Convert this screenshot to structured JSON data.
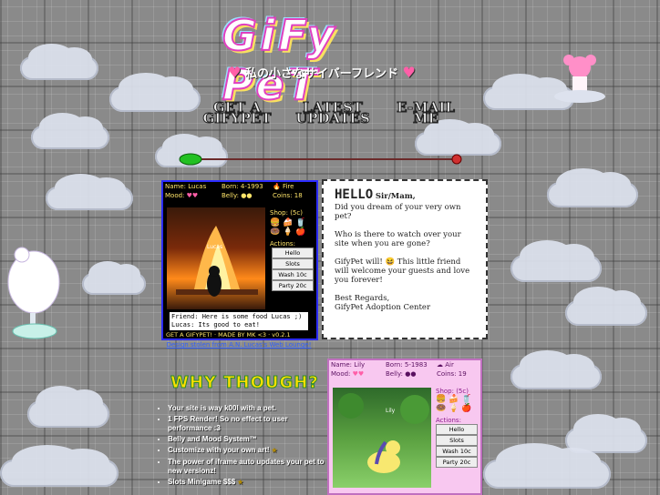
{
  "header": {
    "logo_text": "GiFy PeT",
    "subtitle": "私の小さなサイバーフレンド"
  },
  "nav": [
    {
      "line1": "GET A",
      "line2": "GIFYPET"
    },
    {
      "line1": "LATEST",
      "line2": "UPDATES"
    },
    {
      "line1": "E-MAIL",
      "line2": "ME"
    }
  ],
  "pet1": {
    "name": "Name: Lucas",
    "born": "Born: 4-1993",
    "element": "Fire",
    "mood": "Mood:",
    "belly": "Belly:",
    "coins": "Coins: 18",
    "shop": "Shop: (5c)",
    "actions": "Actions:",
    "buttons": [
      "Hello",
      "Slots",
      "Wash 10c",
      "Party 20c"
    ],
    "scene_label": "Lucas",
    "chat_line1": "Friend: Here is some food Lucas ;)",
    "chat_line2": "Lucas: Its good to eat!",
    "credit": "GET A GIFYPET! · MADE BY MK <3 · v0.2.1"
  },
  "stolen_link": "Design stolen from A.N. Lucas's Web Lounge!",
  "hello_box": {
    "hello": "HELLO",
    "salutation": "Sir/Mam,",
    "p1": "Did you dream of your very own pet?",
    "p2": "Who is there to watch over your site when you are gone?",
    "p3": "GifyPet will! 😆 This little friend will welcome your guests and love you forever!",
    "sign1": "Best Regards,",
    "sign2": "GifyPet Adoption Center"
  },
  "why": {
    "title": "WHY THOUGH?",
    "items": [
      "Your site is way k00l with a pet.",
      "1 FPS Render! So no effect to user performance :3",
      "Belly and Mood System™",
      "Customize with your own art!",
      "The power of iframe auto updates your pet to new versionz!",
      "Slots Minigame $$$"
    ]
  },
  "pet2": {
    "name": "Name: Lily",
    "born": "Born: 5-1983",
    "element": "Air",
    "mood": "Mood:",
    "belly": "Belly:",
    "coins": "Coins: 19",
    "shop": "Shop: (5c)",
    "actions": "Actions:",
    "buttons": [
      "Hello",
      "Slots",
      "Wash 10c",
      "Party 20c"
    ],
    "scene_label": "Lily"
  },
  "colors": {
    "accent_pink": "#ff5fa8",
    "link_blue": "#3060ff",
    "gold": "#ffe000",
    "pet_frame": "#2c2cff"
  }
}
